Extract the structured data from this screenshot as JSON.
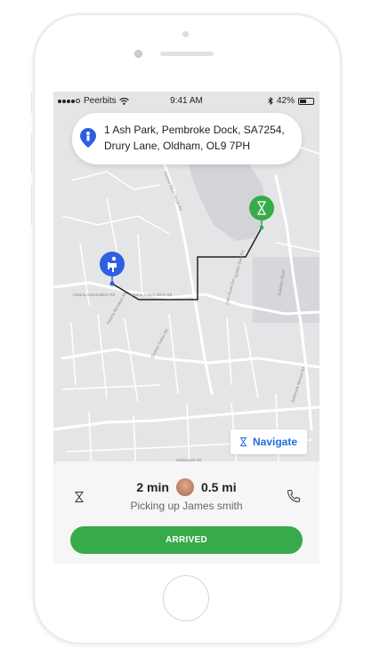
{
  "status_bar": {
    "carrier": "Peerbits",
    "time": "9:41 AM",
    "battery": "42%"
  },
  "destination": {
    "line1": "1 Ash Park, Pembroke Dock, SA7254,",
    "line2": "Drury Lane, Oldham, OL9 7PH"
  },
  "map": {
    "street_labels": [
      "Kataria Automobiles Rd",
      "Kataria Automobiles Rd",
      "Kataria Mondesir Rd",
      "Samuel Bikes Street Rd",
      "Clayton Sultan Rd",
      "Lake Road Ave",
      "Spitfire Slow Rd",
      "Sparkles Road",
      "Sanbrook Morten Rd",
      "Shilpgraph Rd"
    ],
    "route_color": "#222222",
    "pickup_pin_color": "#2f5fe0",
    "destination_pin_color": "#37ab49"
  },
  "navigate": {
    "label": "Navigate",
    "icon": "hourglass-icon"
  },
  "trip": {
    "eta": "2 min",
    "distance": "0.5 mi",
    "pickup_text": "Picking up James smith"
  },
  "actions": {
    "arrived_label": "ARRIVED",
    "call_icon": "phone-icon"
  },
  "colors": {
    "accent_green": "#37ab49",
    "accent_blue": "#1e6fd9"
  }
}
